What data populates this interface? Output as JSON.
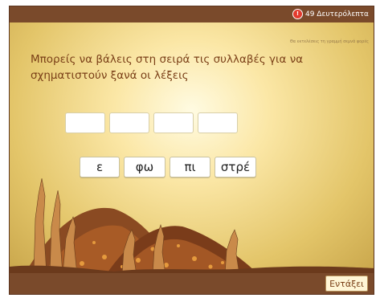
{
  "timer": {
    "label": "49 Δευτερόλεπτα",
    "subtitle": "Θα εκτελέσεις τη γραμμή σεμνά φορές"
  },
  "prompt": "Μπορείς να βάλεις στη σειρά τις συλλαβές για να σχηματιστούν ξανά οι λέξεις",
  "slots": [
    "",
    "",
    "",
    ""
  ],
  "tiles": [
    "ε",
    "φω",
    "πι",
    "στρέ"
  ],
  "ok_button": "Εντάξει",
  "colors": {
    "frame": "#7a4a2b",
    "title": "#7a3f17",
    "timer_badge": "#e23a2e"
  }
}
